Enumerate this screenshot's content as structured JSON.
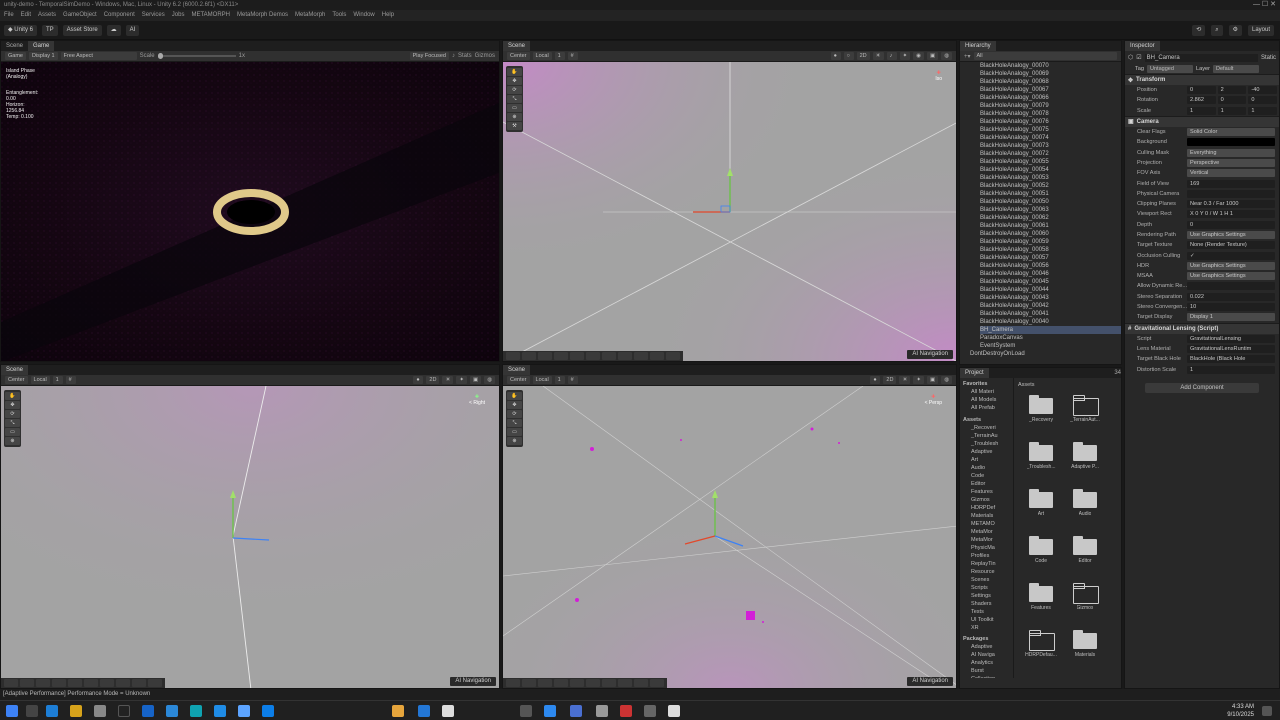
{
  "window": {
    "title": "unity-demo - TemporalSimDemo - Windows, Mac, Linux - Unity 6.2 (6000.2.6f1) <DX11>"
  },
  "menu": [
    "File",
    "Edit",
    "Assets",
    "GameObject",
    "Component",
    "Services",
    "Jobs",
    "METAMORPH",
    "MetaMorph Demos",
    "MetaMorph",
    "Tools",
    "Window",
    "Help"
  ],
  "toolbar": {
    "account": "Unity 6",
    "tp": "TP",
    "asset_store": "Asset Store",
    "ai": "AI",
    "layout": "Layout",
    "play": "▶",
    "pause": "❚❚",
    "step": "▶❚"
  },
  "game_panel": {
    "tab_scene": "Scene",
    "tab_game": "Game",
    "mode": "Game",
    "display": "Display 1",
    "aspect": "Free Aspect",
    "scale_label": "Scale",
    "scale_value": "1x",
    "play_focused": "Play Focused",
    "stats": "Stats",
    "gizmos": "Gizmos",
    "overlay": {
      "phase": "Island Phase",
      "phase_sub": "(Analogy)",
      "ent_label": "Entanglement:",
      "ent_value": "0.00",
      "horizon": "Horizon:",
      "horizon_val": "1256.84",
      "temp": "Temp: 0.100"
    }
  },
  "scene_tr": {
    "tab": "Scene",
    "pivot": "Center",
    "space": "Local",
    "snap": "1",
    "mode2d": "2D",
    "nav": "AI Navigation",
    "view_label": "Iso"
  },
  "scene_bl": {
    "tab": "Scene",
    "pivot": "Center",
    "space": "Local",
    "snap": "1",
    "mode2d": "2D",
    "nav": "AI Navigation",
    "view_label": "< Right"
  },
  "scene_br": {
    "tab": "Scene",
    "pivot": "Center",
    "space": "Local",
    "snap": "1",
    "mode2d": "2D",
    "nav": "AI Navigation",
    "view_label": "< Persp"
  },
  "hierarchy": {
    "tab": "Hierarchy",
    "search_placeholder": "All",
    "items": [
      "BlackHoleAnalogy_00070",
      "BlackHoleAnalogy_00069",
      "BlackHoleAnalogy_00068",
      "BlackHoleAnalogy_00067",
      "BlackHoleAnalogy_00066",
      "BlackHoleAnalogy_00079",
      "BlackHoleAnalogy_00078",
      "BlackHoleAnalogy_00076",
      "BlackHoleAnalogy_00075",
      "BlackHoleAnalogy_00074",
      "BlackHoleAnalogy_00073",
      "BlackHoleAnalogy_00072",
      "BlackHoleAnalogy_00055",
      "BlackHoleAnalogy_00054",
      "BlackHoleAnalogy_00053",
      "BlackHoleAnalogy_00052",
      "BlackHoleAnalogy_00051",
      "BlackHoleAnalogy_00050",
      "BlackHoleAnalogy_00063",
      "BlackHoleAnalogy_00062",
      "BlackHoleAnalogy_00061",
      "BlackHoleAnalogy_00060",
      "BlackHoleAnalogy_00059",
      "BlackHoleAnalogy_00058",
      "BlackHoleAnalogy_00057",
      "BlackHoleAnalogy_00056",
      "BlackHoleAnalogy_00046",
      "BlackHoleAnalogy_00045",
      "BlackHoleAnalogy_00044",
      "BlackHoleAnalogy_00043",
      "BlackHoleAnalogy_00042",
      "BlackHoleAnalogy_00041",
      "BlackHoleAnalogy_00040"
    ],
    "selected": "BH_Camera",
    "after": [
      "ParadoxCanvas",
      "EventSystem"
    ],
    "dontdestroy": "DontDestroyOnLoad"
  },
  "project": {
    "tab": "Project",
    "breadcrumb": "Assets",
    "count": "34",
    "favorites_label": "Favorites",
    "favorites": [
      "All Materi",
      "All Models",
      "All Prefab"
    ],
    "assets_label": "Assets",
    "tree": [
      "_Recoveri",
      "_TerrainAu",
      "_Troublesh",
      "Adaptive",
      "Art",
      "Audio",
      "Code",
      "Editor",
      "Features",
      "Gizmos",
      "HDRPDef",
      "Materials",
      "METAMO",
      "MetaMor",
      "MetaMor",
      "PhysicMa",
      "Profiles",
      "ReplayTin",
      "Resource",
      "Scenes",
      "Scripts",
      "Settings",
      "Shaders",
      "Tests",
      "UI Toolkit",
      "XR"
    ],
    "packages_label": "Packages",
    "packages": [
      "Adaptive",
      "AI Naviga",
      "Analytics",
      "Burst",
      "Collection"
    ],
    "folders": [
      {
        "name": "_Recovery",
        "outline": false
      },
      {
        "name": "_TerrainAut...",
        "outline": true
      },
      {
        "name": "_Troublesh...",
        "outline": false
      },
      {
        "name": "Adaptive P...",
        "outline": false
      },
      {
        "name": "Art",
        "outline": false
      },
      {
        "name": "Audio",
        "outline": false
      },
      {
        "name": "Code",
        "outline": false
      },
      {
        "name": "Editor",
        "outline": false
      },
      {
        "name": "Features",
        "outline": false
      },
      {
        "name": "Gizmos",
        "outline": true
      },
      {
        "name": "HDRPDefau...",
        "outline": true
      },
      {
        "name": "Materials",
        "outline": false
      }
    ]
  },
  "inspector": {
    "tab": "Inspector",
    "object_name": "BH_Camera",
    "static": "Static",
    "tag_label": "Tag",
    "tag": "Untagged",
    "layer_label": "Layer",
    "layer": "Default",
    "transform": {
      "header": "Transform",
      "position": {
        "label": "Position",
        "x": "0",
        "y": "2",
        "z": "-40"
      },
      "rotation": {
        "label": "Rotation",
        "x": "2.862",
        "y": "0",
        "z": "0"
      },
      "scale": {
        "label": "Scale",
        "x": "1",
        "y": "1",
        "z": "1"
      }
    },
    "camera": {
      "header": "Camera",
      "rows": [
        [
          "Clear Flags",
          "Solid Color"
        ],
        [
          "Background",
          ""
        ],
        [
          "Culling Mask",
          "Everything"
        ],
        [
          "Projection",
          "Perspective"
        ],
        [
          "FOV Axis",
          "Vertical"
        ],
        [
          "Field of View",
          "169"
        ],
        [
          "Physical Camera",
          ""
        ],
        [
          "Clipping Planes",
          "Near 0.3 / Far 1000"
        ],
        [
          "Viewport Rect",
          "X 0  Y 0 / W 1  H 1"
        ],
        [
          "Depth",
          "0"
        ],
        [
          "Rendering Path",
          "Use Graphics Settings"
        ],
        [
          "Target Texture",
          "None (Render Texture)"
        ],
        [
          "Occlusion Culling",
          "✓"
        ],
        [
          "HDR",
          "Use Graphics Settings"
        ],
        [
          "MSAA",
          "Use Graphics Settings"
        ],
        [
          "Allow Dynamic Re...",
          ""
        ],
        [
          "Stereo Separation",
          "0.022"
        ],
        [
          "Stereo Convergen...",
          "10"
        ],
        [
          "Target Display",
          "Display 1"
        ]
      ]
    },
    "lensing": {
      "header": "Gravitational Lensing (Script)",
      "rows": [
        [
          "Script",
          "GravitationalLensing"
        ],
        [
          "Lens Material",
          "GravitationalLensRuntim"
        ],
        [
          "Target Black Hole",
          "BlackHole (Black Hole"
        ],
        [
          "Distortion Scale",
          "1"
        ]
      ]
    },
    "add_component": "Add Component"
  },
  "status": {
    "message": "[Adaptive Performance] Performance Mode = Unknown"
  },
  "taskbar": {
    "time": "4:33 AM",
    "date": "9/10/2025"
  },
  "colors": {
    "accent": "#3d82f5",
    "selection": "#44516b",
    "magenta": "#d21fd7",
    "ring": "#e0c98a"
  }
}
